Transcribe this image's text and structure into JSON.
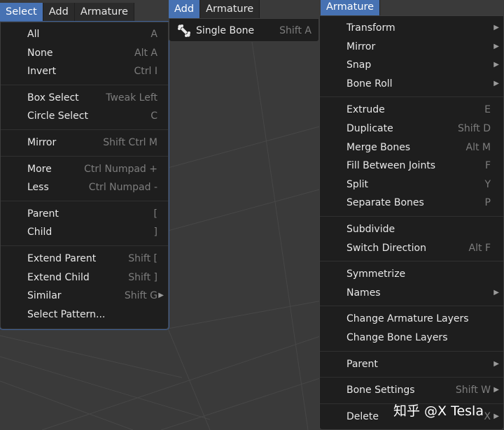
{
  "colors": {
    "accent": "#4772b3",
    "menu_bg": "#1e1e1e",
    "viewport_bg": "#3a3a3a"
  },
  "select_header": {
    "tabs": [
      "Select",
      "Add",
      "Armature"
    ]
  },
  "add_header": {
    "tabs": [
      "Add",
      "Armature"
    ]
  },
  "armature_header": {
    "tabs": [
      "Armature"
    ]
  },
  "select_menu": {
    "groups": [
      [
        {
          "label": "All",
          "shortcut": "A"
        },
        {
          "label": "None",
          "shortcut": "Alt A"
        },
        {
          "label": "Invert",
          "shortcut": "Ctrl I"
        }
      ],
      [
        {
          "label": "Box Select",
          "shortcut": "Tweak Left"
        },
        {
          "label": "Circle Select",
          "shortcut": "C"
        }
      ],
      [
        {
          "label": "Mirror",
          "shortcut": "Shift Ctrl M"
        }
      ],
      [
        {
          "label": "More",
          "shortcut": "Ctrl Numpad +"
        },
        {
          "label": "Less",
          "shortcut": "Ctrl Numpad -"
        }
      ],
      [
        {
          "label": "Parent",
          "shortcut": "["
        },
        {
          "label": "Child",
          "shortcut": "]"
        }
      ],
      [
        {
          "label": "Extend Parent",
          "shortcut": "Shift ["
        },
        {
          "label": "Extend Child",
          "shortcut": "Shift ]"
        },
        {
          "label": "Similar",
          "shortcut": "Shift G",
          "submenu": true
        },
        {
          "label": "Select Pattern...",
          "shortcut": ""
        }
      ]
    ]
  },
  "add_menu": {
    "items": [
      {
        "label": "Single Bone",
        "shortcut": "Shift A",
        "icon": "bone-icon"
      }
    ]
  },
  "armature_menu": {
    "groups": [
      [
        {
          "label": "Transform",
          "shortcut": "",
          "submenu": true
        },
        {
          "label": "Mirror",
          "shortcut": "",
          "submenu": true
        },
        {
          "label": "Snap",
          "shortcut": "",
          "submenu": true
        },
        {
          "label": "Bone Roll",
          "shortcut": "",
          "submenu": true
        }
      ],
      [
        {
          "label": "Extrude",
          "shortcut": "E"
        },
        {
          "label": "Duplicate",
          "shortcut": "Shift D"
        },
        {
          "label": "Merge Bones",
          "shortcut": "Alt M"
        },
        {
          "label": "Fill Between Joints",
          "shortcut": "F"
        },
        {
          "label": "Split",
          "shortcut": "Y"
        },
        {
          "label": "Separate Bones",
          "shortcut": "P"
        }
      ],
      [
        {
          "label": "Subdivide",
          "shortcut": ""
        },
        {
          "label": "Switch Direction",
          "shortcut": "Alt F"
        }
      ],
      [
        {
          "label": "Symmetrize",
          "shortcut": ""
        },
        {
          "label": "Names",
          "shortcut": "",
          "submenu": true
        }
      ],
      [
        {
          "label": "Change Armature Layers",
          "shortcut": ""
        },
        {
          "label": "Change Bone Layers",
          "shortcut": ""
        }
      ],
      [
        {
          "label": "Parent",
          "shortcut": "",
          "submenu": true
        }
      ],
      [
        {
          "label": "Bone Settings",
          "shortcut": "Shift W",
          "submenu": true
        }
      ],
      [
        {
          "label": "Delete",
          "shortcut": "X",
          "submenu": true
        }
      ]
    ]
  },
  "watermark": "知乎 @X Tesla"
}
